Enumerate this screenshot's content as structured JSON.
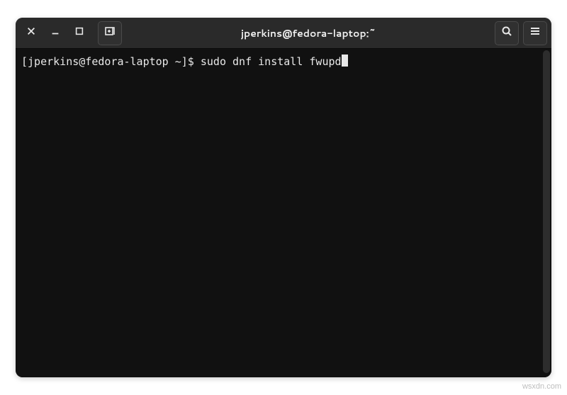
{
  "window": {
    "title": "jperkins@fedora-laptop:~"
  },
  "terminal": {
    "prompt": "[jperkins@fedora-laptop ~]$ ",
    "command": "sudo dnf install fwupd"
  },
  "icons": {
    "close": "close-icon",
    "minimize": "minimize-icon",
    "maximize": "maximize-icon",
    "new_tab": "new-tab-icon",
    "search": "search-icon",
    "menu": "hamburger-menu-icon"
  },
  "watermark": "wsxdn.com"
}
